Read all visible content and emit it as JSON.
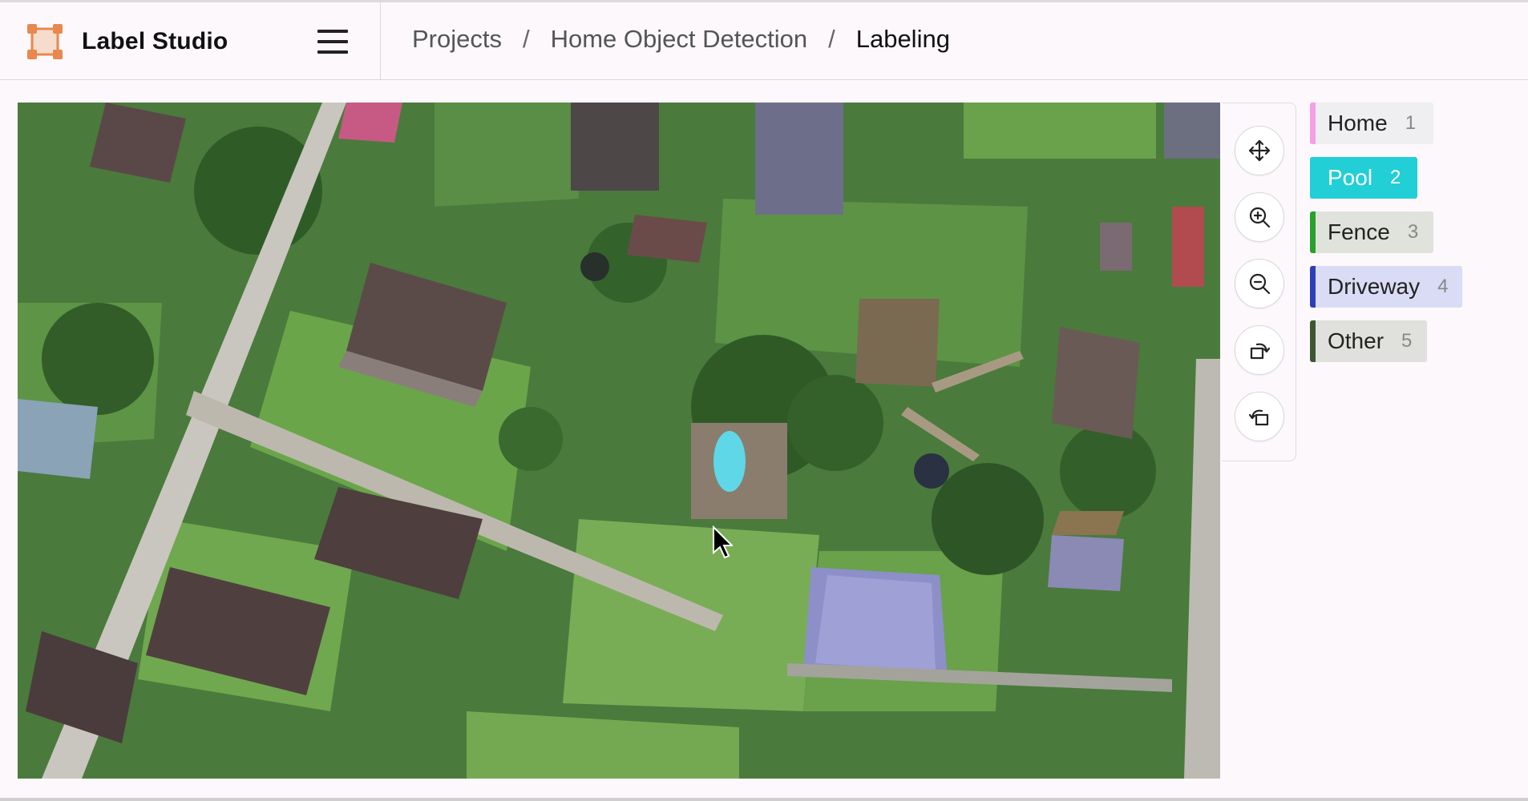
{
  "app": {
    "name": "Label Studio",
    "menu_icon": "hamburger-menu-icon",
    "logo_icon": "label-studio-logo-icon"
  },
  "breadcrumb": [
    {
      "label": "Projects"
    },
    {
      "label": "Home Object Detection"
    },
    {
      "label": "Labeling"
    }
  ],
  "breadcrumb_separator": "/",
  "toolbar": [
    {
      "name": "pan-tool-button",
      "icon": "move-arrows-icon"
    },
    {
      "name": "zoom-in-button",
      "icon": "zoom-in-icon"
    },
    {
      "name": "zoom-out-button",
      "icon": "zoom-out-icon"
    },
    {
      "name": "rotate-left-button",
      "icon": "rotate-left-icon"
    },
    {
      "name": "rotate-right-button",
      "icon": "rotate-right-icon"
    }
  ],
  "labels": [
    {
      "text": "Home",
      "key": "1",
      "color": "#f49fe8",
      "selected": false
    },
    {
      "text": "Pool",
      "key": "2",
      "color": "#22cfd6",
      "selected": true
    },
    {
      "text": "Fence",
      "key": "3",
      "color": "#2aa12e",
      "selected": false
    },
    {
      "text": "Driveway",
      "key": "4",
      "color": "#2d3fb8",
      "selected": false
    },
    {
      "text": "Other",
      "key": "5",
      "color": "#3f5533",
      "selected": false
    }
  ],
  "image": {
    "subject": "aerial-photo-of-suburban-houses-and-yards"
  },
  "colors": {
    "accent": "#22cfd6",
    "background": "#fcf8fc"
  }
}
